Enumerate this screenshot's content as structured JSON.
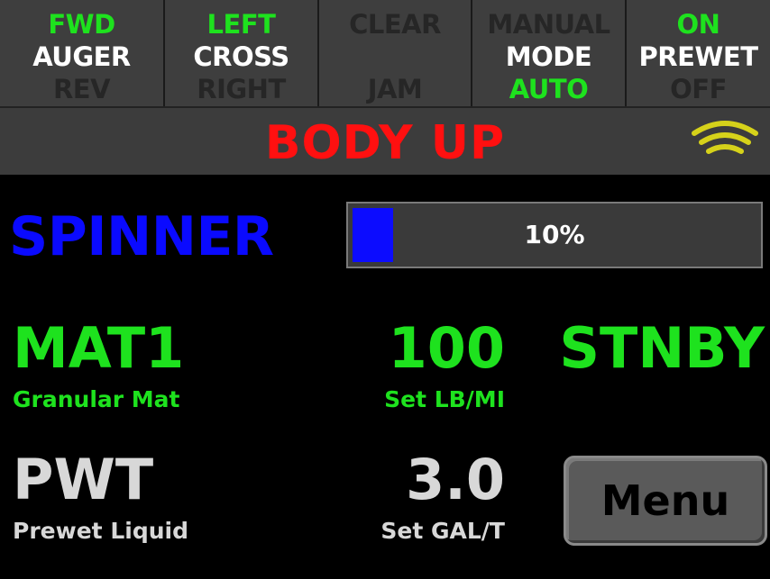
{
  "top_buttons": [
    {
      "line1": "FWD",
      "line2": "AUGER",
      "line3": "REV"
    },
    {
      "line1": "LEFT",
      "line2": "CROSS",
      "line3": "RIGHT"
    },
    {
      "line1": "CLEAR",
      "line2": "",
      "line3": "JAM"
    },
    {
      "line1": "MANUAL",
      "line2": "MODE",
      "line3": "AUTO"
    },
    {
      "line1": "ON",
      "line2": "PREWET",
      "line3": "OFF"
    }
  ],
  "status": {
    "text": "BODY UP"
  },
  "signal_icon": "wifi-signal-icon",
  "spinner": {
    "label": "SPINNER",
    "value_text": "10%",
    "value": 0.1
  },
  "material": {
    "name": "MAT1",
    "description": "Granular Mat",
    "rate": "100",
    "rate_unit": "Set LB/MI",
    "state": "STNBY"
  },
  "prewet": {
    "name": "PWT",
    "description": "Prewet Liquid",
    "rate": "3.0",
    "rate_unit": "Set GAL/T"
  },
  "menu": {
    "label": "Menu"
  },
  "colors": {
    "active_green": "#1ee21e",
    "inactive_text": "#262626",
    "status_red": "#ff1010",
    "spinner_blue": "#0a0aff",
    "panel_gray": "#3c3c3c",
    "signal_yellow": "#d6d21a"
  }
}
